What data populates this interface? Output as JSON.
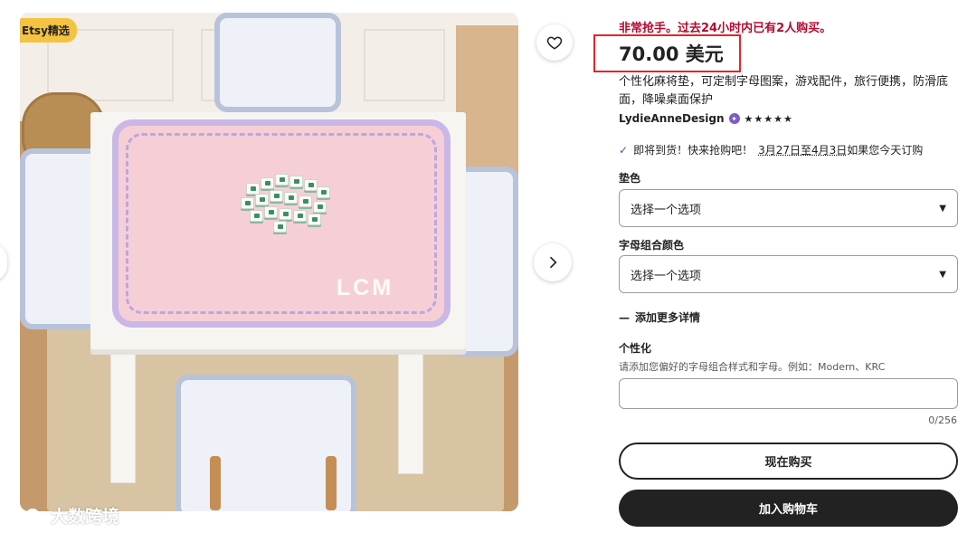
{
  "listing": {
    "badge": "Etsy精选",
    "urgency": "非常抢手。过去24小时内已有2人购买。",
    "price": "70.00 美元",
    "title": "个性化麻将垫，可定制字母图案，游戏配件，旅行便携，防滑底面，降噪桌面保护",
    "monogram": "LCM"
  },
  "shop": {
    "name": "LydieAnneDesign",
    "rating_stars": 5,
    "stars_text": "★★★★★"
  },
  "shipping": {
    "check": "✓",
    "prefix": "即将到货！快来抢购吧！",
    "dates": "3月27日至4月3日",
    "suffix": "如果您今天订购"
  },
  "options": {
    "mat_color_label": "垫色",
    "mat_color_value": "选择一个选项",
    "letter_color_label": "字母组合颜色",
    "letter_color_value": "选择一个选项"
  },
  "details": {
    "more_icon": "—",
    "more_label": "添加更多详情"
  },
  "personalization": {
    "label": "个性化",
    "hint": "请添加您偏好的字母组合样式和字母。例如：Modern、KRC",
    "counter": "0/256"
  },
  "actions": {
    "buy_now": "现在购买",
    "add_to_cart": "加入购物车"
  },
  "watermark": "大数跨境",
  "colors": {
    "urgency": "#b3092e",
    "highlight_box": "#e5252a",
    "primary_button": "#222222",
    "badge": "#f3c341"
  }
}
